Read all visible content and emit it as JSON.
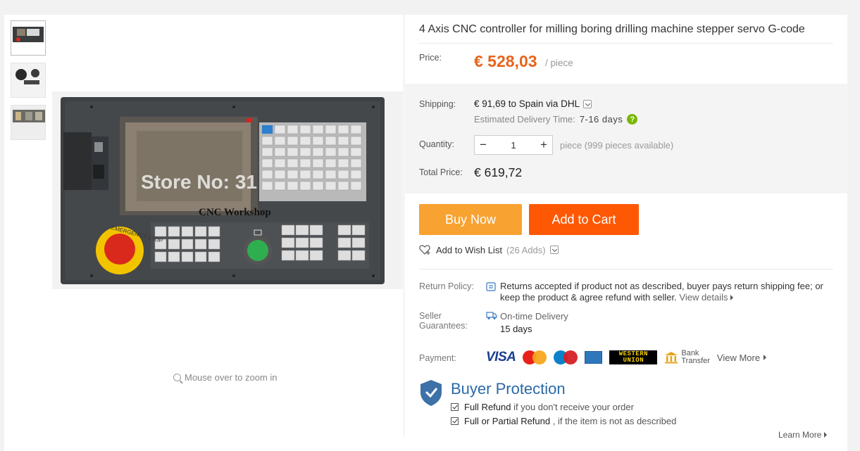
{
  "product": {
    "title": "4 Axis CNC controller for milling boring drilling machine stepper servo G-code",
    "thumbnails": [
      "thumb-controller-front",
      "thumb-handwheel",
      "thumb-controller-back"
    ]
  },
  "main_image": {
    "watermark": "Store No: 31",
    "panel_label": "CNC Workshop",
    "estop_label": "EMERGENCY STOP"
  },
  "zoom_hint": "Mouse over to zoom in",
  "price": {
    "label": "Price:",
    "value": "€ 528,03",
    "unit": "/ piece"
  },
  "shipping": {
    "label": "Shipping:",
    "value": "€ 91,69 to Spain via DHL",
    "delivery_label": "Estimated Delivery Time:",
    "delivery_days": "7-16  days",
    "help_icon": "question-icon"
  },
  "quantity": {
    "label": "Quantity:",
    "value": "1",
    "minus": "−",
    "plus": "+",
    "available": "piece (999 pieces available)"
  },
  "total": {
    "label": "Total Price:",
    "value": "€ 619,72"
  },
  "actions": {
    "buy_now": "Buy Now",
    "add_to_cart": "Add to Cart",
    "wish_list": "Add to Wish List",
    "wish_count": "(26 Adds)"
  },
  "return_policy": {
    "label": "Return Policy:",
    "text": "Returns accepted if product not as described, buyer pays return shipping fee; or keep the product & agree refund with seller.",
    "view_details": "View details"
  },
  "seller_guarantees": {
    "label_line1": "Seller",
    "label_line2": "Guarantees:",
    "item": "On-time Delivery",
    "days": "15 days"
  },
  "payment": {
    "label": "Payment:",
    "visa": "VISA",
    "mastercard": "MasterCard",
    "maestro": "Maestro",
    "western_union_1": "WESTERN",
    "western_union_2": "UNION",
    "bank_line1": "Bank",
    "bank_line2": "Transfer",
    "view_more": "View More"
  },
  "buyer_protection": {
    "title": "Buyer Protection",
    "item1_bold": "Full Refund",
    "item1_rest": " if you don't receive your order",
    "item2_bold": "Full or Partial Refund",
    "item2_rest": " , if the item is not as described",
    "learn_more": "Learn More"
  },
  "colors": {
    "price": "#e8641b",
    "buy_now": "#f8a231",
    "add_to_cart": "#fe5805",
    "buyer_protection": "#2a6aa8"
  }
}
